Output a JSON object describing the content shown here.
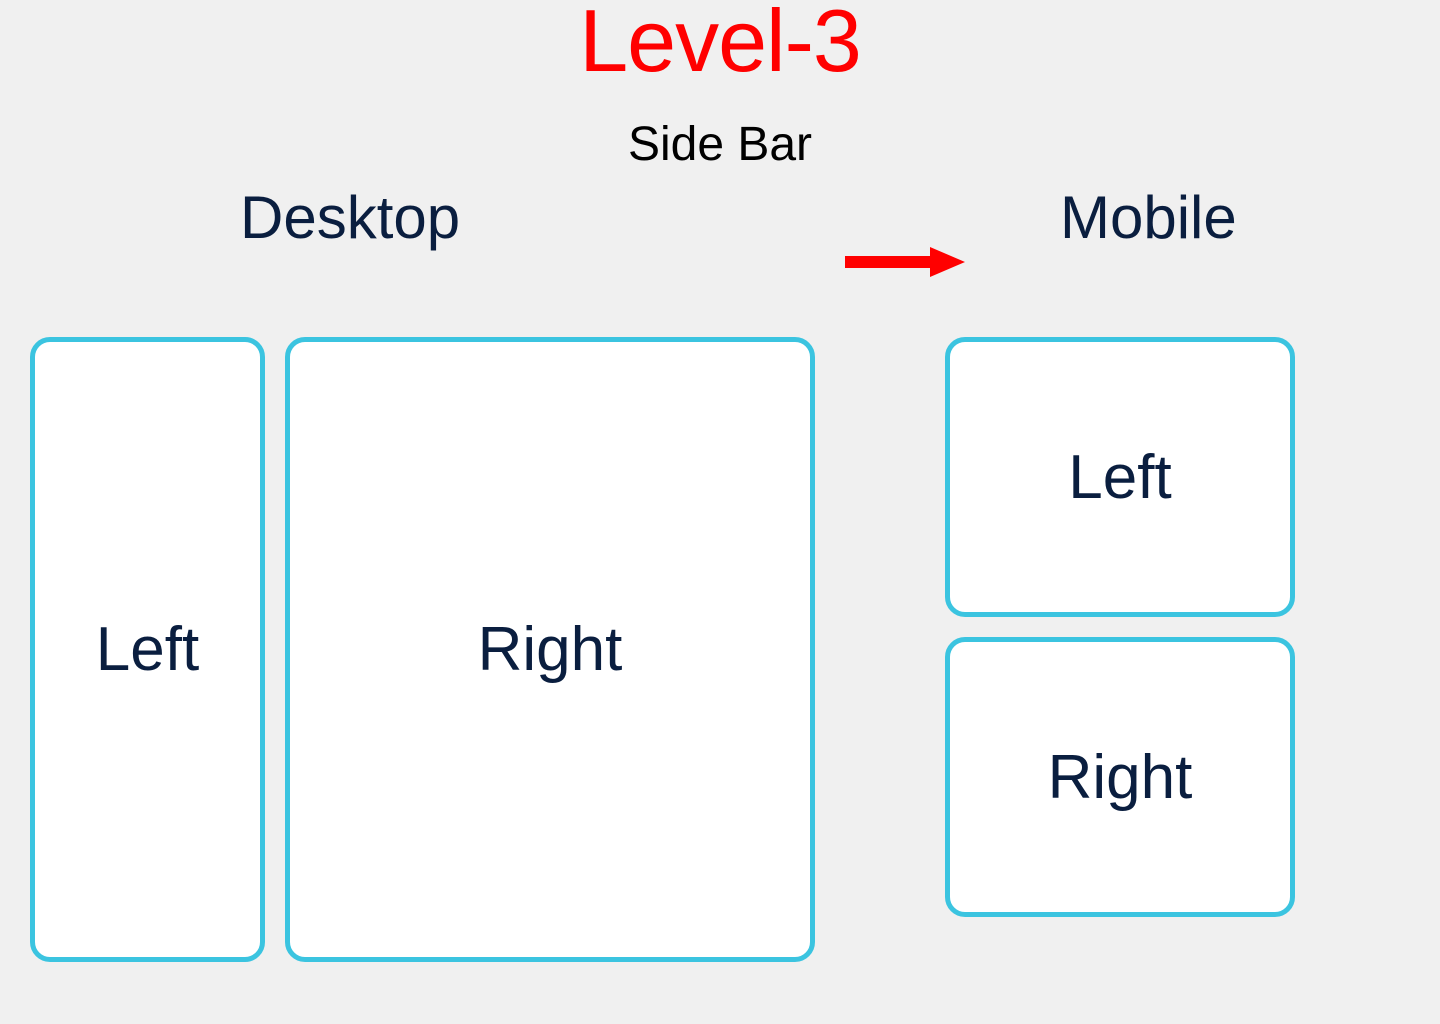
{
  "title": "Level-3",
  "subtitle": "Side Bar",
  "desktop_label": "Desktop",
  "mobile_label": "Mobile",
  "desktop": {
    "left": "Left",
    "right": "Right"
  },
  "mobile": {
    "left": "Left",
    "right": "Right"
  },
  "colors": {
    "title": "#ff0000",
    "text": "#0a1e3f",
    "border": "#3bc4e0",
    "arrow": "#ff0000"
  }
}
